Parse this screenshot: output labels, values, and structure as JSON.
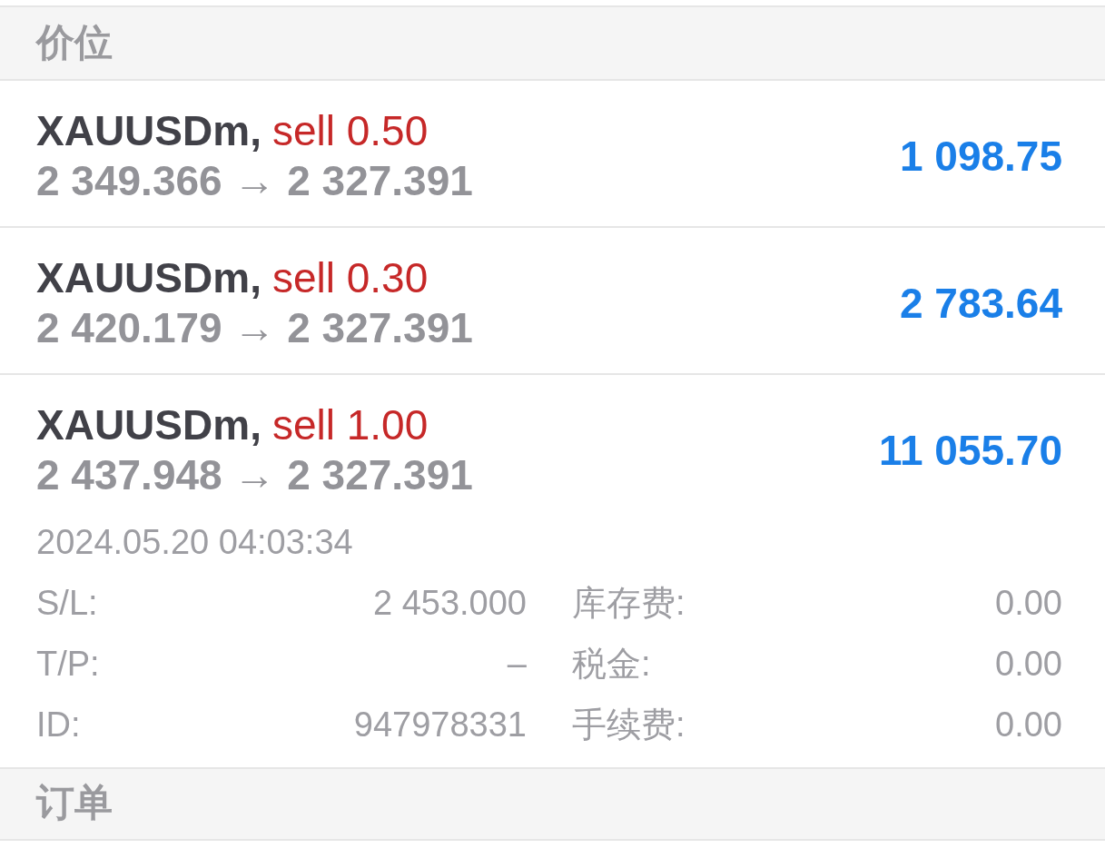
{
  "positions_header": {
    "title": "价位"
  },
  "positions": [
    {
      "symbol": "XAUUSDm,",
      "trade": "sell 0.50",
      "prices": "2 349.366 → 2 327.391",
      "profit": "1 098.75"
    },
    {
      "symbol": "XAUUSDm,",
      "trade": "sell 0.30",
      "prices": "2 420.179 → 2 327.391",
      "profit": "2 783.64"
    },
    {
      "symbol": "XAUUSDm,",
      "trade": "sell 1.00",
      "prices": "2 437.948 → 2 327.391",
      "profit": "11 055.70",
      "details": {
        "time": "2024.05.20 04:03:34",
        "fields": [
          {
            "label": "S/L:",
            "value": "2 453.000"
          },
          {
            "label": "库存费:",
            "value": "0.00"
          },
          {
            "label": "T/P:",
            "value": "–"
          },
          {
            "label": "税金:",
            "value": "0.00"
          },
          {
            "label": "ID:",
            "value": "947978331"
          },
          {
            "label": "手续费:",
            "value": "0.00"
          }
        ]
      }
    }
  ],
  "orders_header": {
    "title": "订单"
  }
}
